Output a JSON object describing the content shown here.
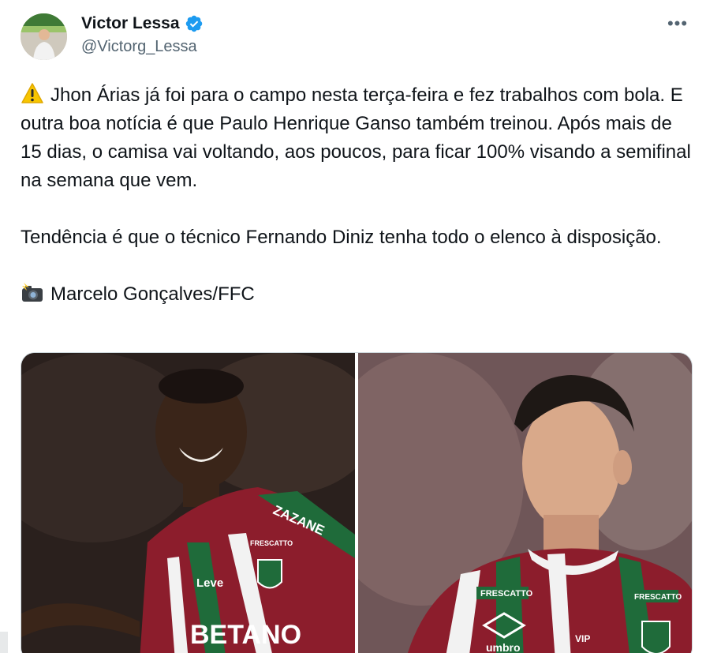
{
  "author": {
    "name": "Victor Lessa",
    "handle": "@Victorg_Lessa",
    "verified": true,
    "verified_color": "#1d9bf0"
  },
  "more_menu": {
    "icon": "more-horizontal-icon",
    "glyph": "•••"
  },
  "tweet": {
    "paragraph1": "Jhon Árias já foi para o campo nesta terça-feira e fez trabalhos com bola. E outra boa notícia é que Paulo Henrique Ganso também treinou. Após mais de 15 dias, o camisa vai voltando, aos poucos, para ficar 100% visando a semifinal na semana que vem.",
    "paragraph1_emoji": "warning-emoji",
    "paragraph2": "Tendência é que o técnico Fernando Diniz tenha todo o elenco à disposição.",
    "credit": "Marcelo Gonçalves/FFC",
    "credit_emoji": "camera-flash-emoji"
  },
  "media": {
    "photos": [
      {
        "description_icon": "player-photo",
        "jersey_texts": [
          "ZAZANE",
          "Leve",
          "FRESCATTO",
          "BETANO"
        ]
      },
      {
        "description_icon": "player-photo",
        "jersey_texts": [
          "FRESCATTO",
          "FRESCATTO",
          "umbro",
          "VIP"
        ]
      }
    ]
  },
  "colors": {
    "text": "#0f1419",
    "secondary": "#536471",
    "jersey_red": "#8c1d2c",
    "jersey_green": "#1f6b3a"
  }
}
